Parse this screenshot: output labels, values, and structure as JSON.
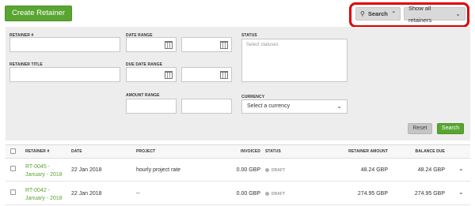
{
  "toolbar": {
    "create_label": "Create Retainer",
    "search_label": "Search",
    "show_all_label": "Show all retainers"
  },
  "filters": {
    "retainer_number_label": "RETAINER #",
    "retainer_title_label": "RETAINER TITLE",
    "date_range_label": "DATE RANGE",
    "due_date_range_label": "DUE DATE RANGE",
    "amount_range_label": "AMOUNT RANGE",
    "status_label": "STATUS",
    "status_placeholder": "Select statuses",
    "currency_label": "CURRENCY",
    "currency_value": "Select a currency",
    "reset_label": "Reset",
    "search_label": "Search"
  },
  "table": {
    "headers": {
      "retainer": "RETAINER #",
      "date": "DATE",
      "project": "PROJECT",
      "invoiced": "INVOICED",
      "status": "STATUS",
      "retainer_amount": "RETAINER AMOUNT",
      "balance_due": "BALANCE DUE"
    },
    "rows": [
      {
        "retainer": "RT-0045 - January - 2018",
        "date": "22 Jan 2018",
        "project": "hourly project rate",
        "invoiced": "0.00 GBP",
        "status": "DRAFT",
        "retainer_amount": "48.24 GBP",
        "balance_due": "48.24 GBP"
      },
      {
        "retainer": "RT-0042 - January - 2018",
        "date": "22 Jan 2018",
        "project": "--",
        "invoiced": "0.00 GBP",
        "status": "DRAFT",
        "retainer_amount": "274.95 GBP",
        "balance_due": "274.95 GBP"
      }
    ]
  },
  "colors": {
    "accent": "#5aa532",
    "highlight": "#e00000"
  }
}
